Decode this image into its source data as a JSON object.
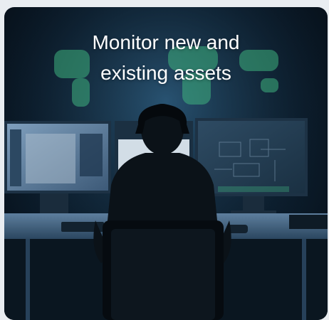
{
  "card": {
    "title_line1": "Monitor new and",
    "title_line2": "existing assets",
    "image_icon": "security-operations-photo",
    "accent_color": "#3fb27f"
  }
}
